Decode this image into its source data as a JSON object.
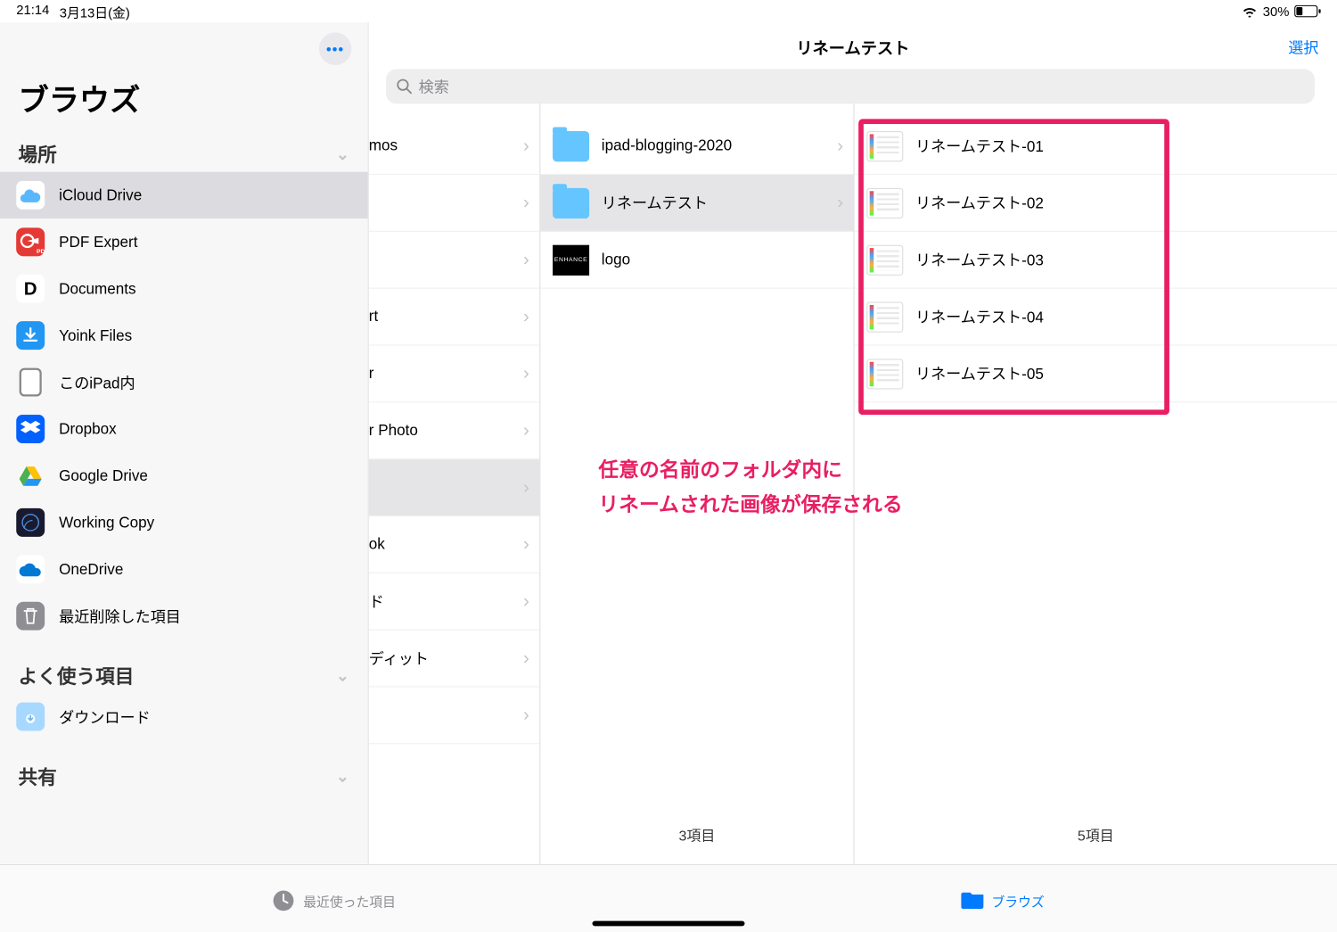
{
  "status": {
    "time": "21:14",
    "date": "3月13日(金)",
    "battery": "30%"
  },
  "sidebar": {
    "title": "ブラウズ",
    "sections": {
      "locations": {
        "header": "場所",
        "items": [
          {
            "label": "iCloud Drive"
          },
          {
            "label": "PDF Expert"
          },
          {
            "label": "Documents"
          },
          {
            "label": "Yoink Files"
          },
          {
            "label": "このiPad内"
          },
          {
            "label": "Dropbox"
          },
          {
            "label": "Google Drive"
          },
          {
            "label": "Working Copy"
          },
          {
            "label": "OneDrive"
          },
          {
            "label": "最近削除した項目"
          }
        ]
      },
      "favorites": {
        "header": "よく使う項目",
        "items": [
          {
            "label": "ダウンロード"
          }
        ]
      },
      "shared": {
        "header": "共有"
      }
    }
  },
  "header": {
    "title": "リネームテスト",
    "select": "選択",
    "search_placeholder": "検索"
  },
  "col0": {
    "items": [
      {
        "label": "mos"
      },
      {
        "label": ""
      },
      {
        "label": ""
      },
      {
        "label": "rt"
      },
      {
        "label": "r"
      },
      {
        "label": "r Photo"
      },
      {
        "label": "",
        "sel": true
      },
      {
        "label": "ok"
      },
      {
        "label": "ド"
      },
      {
        "label": "ディット"
      },
      {
        "label": ""
      }
    ]
  },
  "col1": {
    "items": [
      {
        "label": "ipad-blogging-2020",
        "type": "folder"
      },
      {
        "label": "リネームテスト",
        "type": "folder",
        "sel": true
      },
      {
        "label": "logo",
        "type": "logo"
      }
    ],
    "count": "3項目"
  },
  "col2": {
    "items": [
      {
        "label": "リネームテスト-01"
      },
      {
        "label": "リネームテスト-02"
      },
      {
        "label": "リネームテスト-03"
      },
      {
        "label": "リネームテスト-04"
      },
      {
        "label": "リネームテスト-05"
      }
    ],
    "count": "5項目"
  },
  "annotation": {
    "line1": "任意の名前のフォルダ内に",
    "line2": "リネームされた画像が保存される"
  },
  "tabbar": {
    "recent": "最近使った項目",
    "browse": "ブラウズ"
  }
}
